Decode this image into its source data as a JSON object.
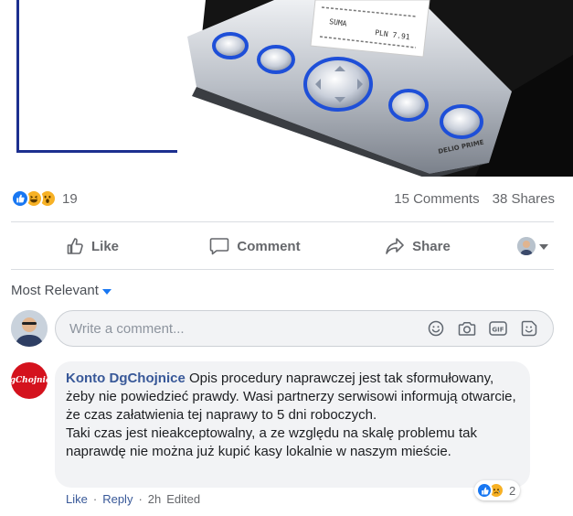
{
  "post": {
    "reaction_count": "19",
    "comments_count": "15 Comments",
    "shares_count": "38 Shares",
    "reactions": [
      "like-reaction",
      "haha-reaction",
      "wow-reaction"
    ],
    "receipt_lines": [
      "SUMA",
      "PLN 7.91"
    ]
  },
  "actions": {
    "like_label": "Like",
    "comment_label": "Comment",
    "share_label": "Share"
  },
  "sort": {
    "label": "Most Relevant"
  },
  "composer": {
    "placeholder": "Write a comment...",
    "icons": [
      "emoji-icon",
      "camera-icon",
      "gif-icon",
      "sticker-icon"
    ]
  },
  "comment": {
    "author": "Konto DgChojnice",
    "text": "Opis procedury naprawczej jest tak sformułowany, żeby nie powiedzieć prawdy. Wasi partnerzy serwisowi informują otwarcie, że czas załatwienia tej naprawy to 5 dni roboczych.\nTaki czas jest nieakceptowalny, a ze względu na skalę problemu tak naprawdę nie można już kupić kasy lokalnie w naszym mieście.",
    "avatar_text": "DgChojnice",
    "reaction_count": "2",
    "like_label": "Like",
    "reply_label": "Reply",
    "time": "2h",
    "edited_label": "Edited"
  },
  "colors": {
    "accent": "#1877f2",
    "link": "#385898",
    "frame_blue": "#1c2f8f",
    "brand_red": "#d4121d"
  }
}
